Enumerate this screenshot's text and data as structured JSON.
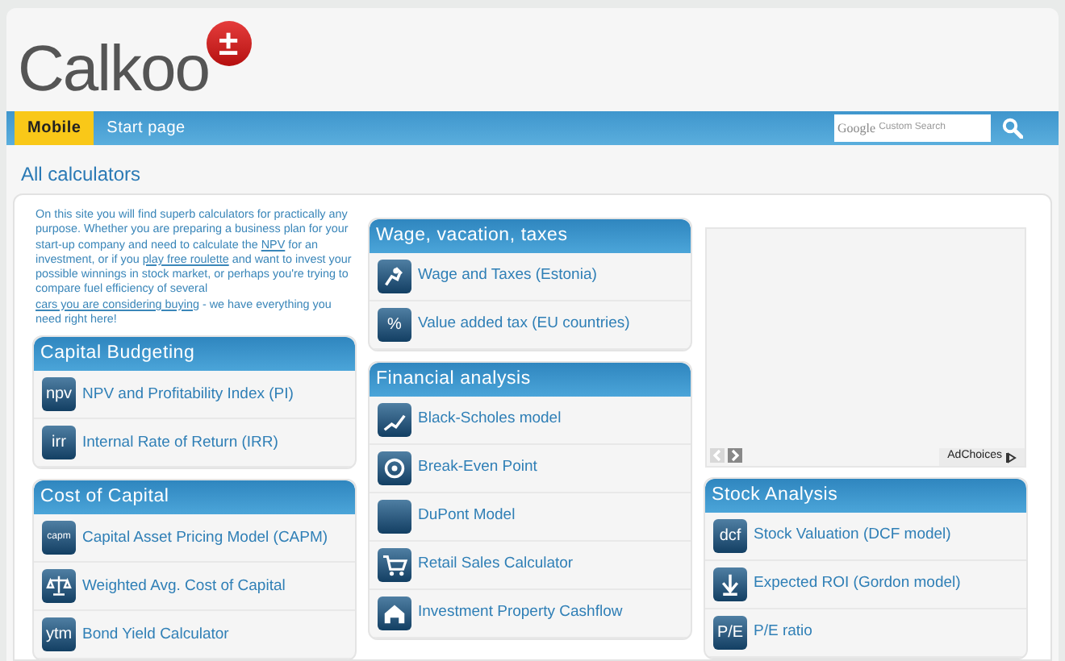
{
  "logo": {
    "text": "Calkoo",
    "badge": "±"
  },
  "nav": {
    "tabs": [
      {
        "label": "Mobile",
        "selected": true
      },
      {
        "label": "Start page",
        "selected": false
      }
    ],
    "search": {
      "logo": "Google",
      "placeholder": "Custom Search"
    }
  },
  "page_title": "All calculators",
  "intro": [
    {
      "kind": "text",
      "text": "On this site you will find superb calculators for practically any purpose. Whether you are preparing a business plan for your start-up company and need to calculate the "
    },
    {
      "kind": "link",
      "text": "NPV"
    },
    {
      "kind": "text",
      "text": " for an investment, or if you "
    },
    {
      "kind": "link",
      "text": "play free roulette"
    },
    {
      "kind": "text",
      "text": " and want to invest your possible winnings in stock market, or perhaps you're trying to compare fuel efficiency of several "
    },
    {
      "kind": "link",
      "text": "cars you are considering buying"
    },
    {
      "kind": "text",
      "text": " - we have everything you need right here!"
    }
  ],
  "columns": [
    [
      {
        "title": "Capital Budgeting",
        "items": [
          {
            "icon_text": "npv",
            "label": "NPV and Profitability Index (PI)"
          },
          {
            "icon_text": "irr",
            "label": "Internal Rate of Return (IRR)"
          }
        ]
      },
      {
        "title": "Cost of Capital",
        "items": [
          {
            "icon_text": "capm",
            "label": "Capital Asset Pricing Model (CAPM)"
          },
          {
            "label": "Weighted Avg. Cost of Capital"
          },
          {
            "icon_text": "ytm",
            "label": "Bond Yield Calculator"
          }
        ]
      }
    ],
    [
      {
        "title": "Wage, vacation, taxes",
        "items": [
          {
            "label": "Wage and Taxes (Estonia)"
          },
          {
            "icon_text": "%",
            "label": "Value added tax (EU countries)"
          }
        ]
      },
      {
        "title": "Financial analysis",
        "items": [
          {
            "label": "Black-Scholes model"
          },
          {
            "label": "Break-Even Point"
          },
          {
            "label": "DuPont Model"
          },
          {
            "label": "Retail Sales Calculator"
          },
          {
            "label": "Investment Property Cashflow"
          }
        ]
      }
    ],
    [
      {
        "title": "Stock Analysis",
        "items": [
          {
            "icon_text": "dcf",
            "label": "Stock Valuation (DCF model)"
          },
          {
            "label": "Expected ROI (Gordon model)"
          },
          {
            "icon_text": "P/E",
            "label": "P/E ratio"
          }
        ]
      }
    ]
  ],
  "ad": {
    "label": "AdChoices"
  }
}
